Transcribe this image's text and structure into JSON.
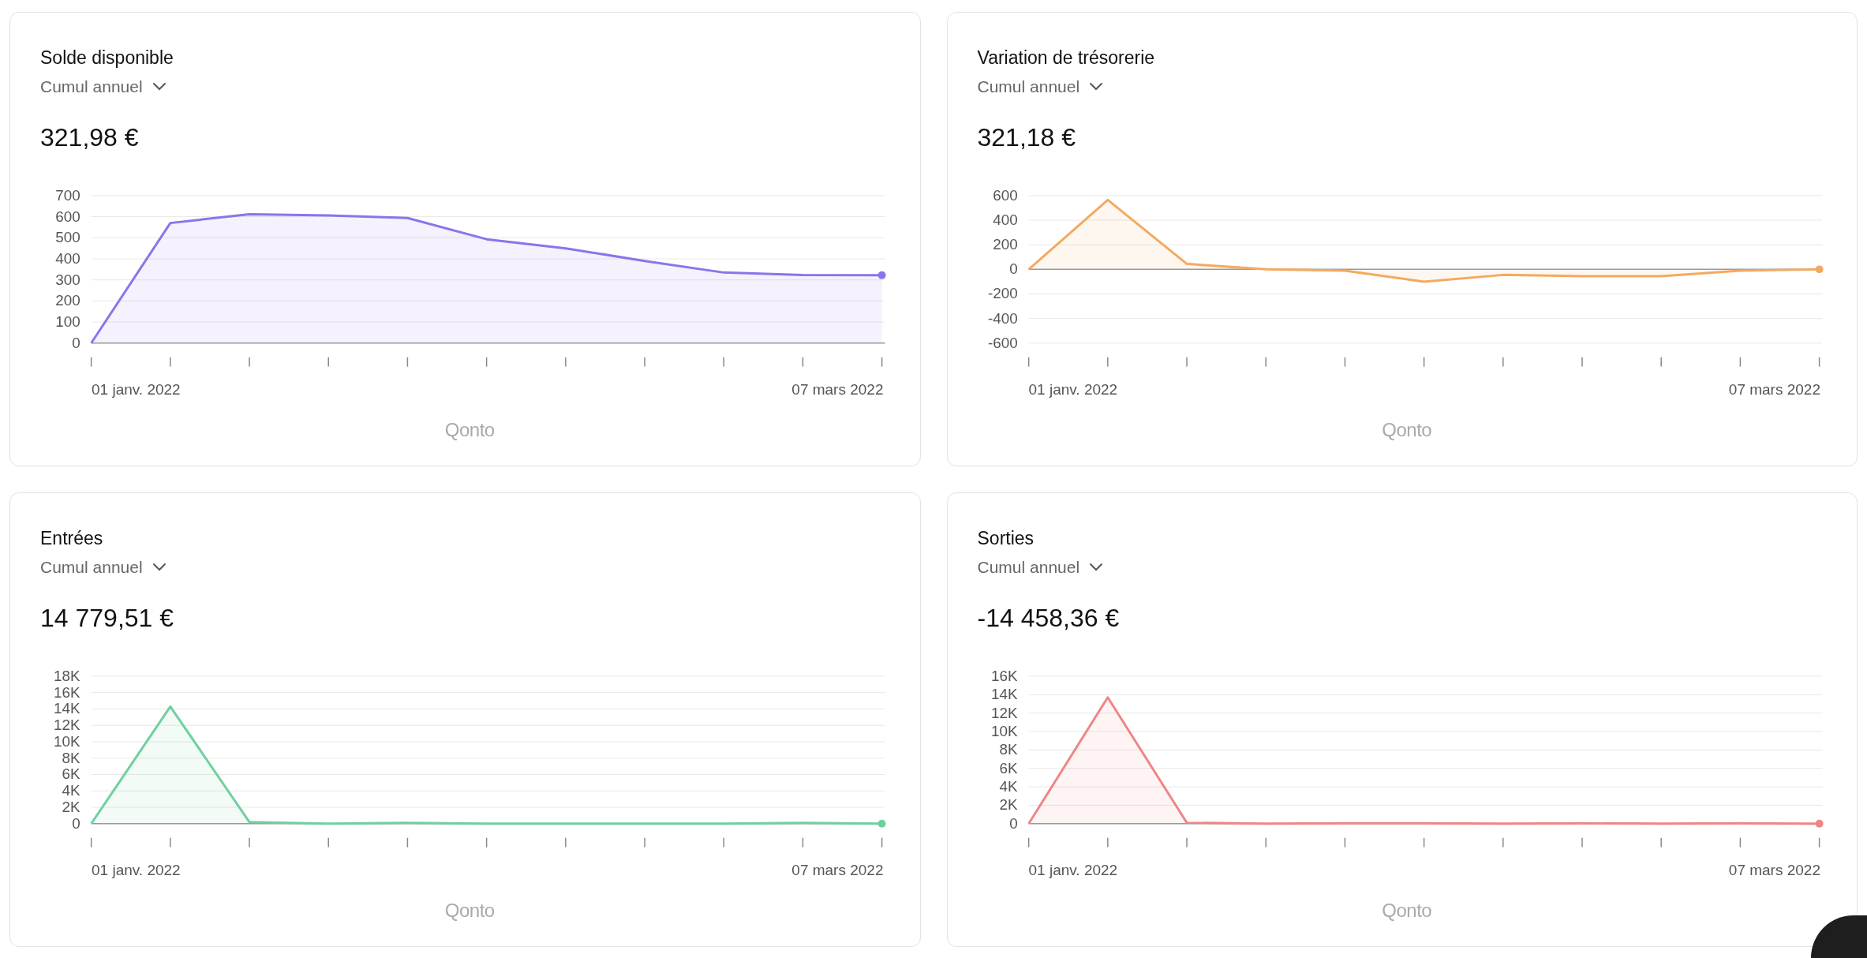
{
  "cards": [
    {
      "title": "Solde disponible",
      "period": "Cumul annuel",
      "amount": "321,98 €",
      "chart_data": {
        "type": "area",
        "grid": true,
        "categories": [
          null,
          null,
          null,
          null,
          null,
          null,
          null,
          null,
          null,
          null,
          null
        ],
        "ylim": [
          0,
          700
        ],
        "yticks": [
          0,
          100,
          200,
          300,
          400,
          500,
          600,
          700
        ],
        "series": [
          {
            "color": "#8b74ea",
            "values": [
              0,
              570,
              612,
              606,
              594,
              493,
              450,
              390,
              335,
              323,
              322
            ]
          }
        ]
      },
      "date_start": "01 janv. 2022",
      "date_end": "07 mars 2022",
      "logo": "Qonto"
    },
    {
      "title": "Variation de trésorerie",
      "period": "Cumul annuel",
      "amount": "321,18 €",
      "chart_data": {
        "type": "area",
        "grid": true,
        "categories": [
          null,
          null,
          null,
          null,
          null,
          null,
          null,
          null,
          null,
          null,
          null
        ],
        "ylim": [
          -600,
          600
        ],
        "yticks": [
          -600,
          -400,
          -200,
          0,
          200,
          400,
          600
        ],
        "series": [
          {
            "color": "#f4a95e",
            "values": [
              0,
              565,
              45,
              0,
              -10,
              -100,
              -45,
              -55,
              -55,
              -10,
              0
            ]
          }
        ]
      },
      "date_start": "01 janv. 2022",
      "date_end": "07 mars 2022",
      "logo": "Qonto"
    },
    {
      "title": "Entrées",
      "period": "Cumul annuel",
      "amount": "14 779,51 €",
      "chart_data": {
        "type": "area",
        "grid": true,
        "categories": [
          null,
          null,
          null,
          null,
          null,
          null,
          null,
          null,
          null,
          null,
          null
        ],
        "ylim": [
          0,
          18000
        ],
        "yticks": [
          0,
          {
            "value": 2000,
            "label": "2K"
          },
          {
            "value": 4000,
            "label": "4K"
          },
          {
            "value": 6000,
            "label": "6K"
          },
          {
            "value": 8000,
            "label": "8K"
          },
          {
            "value": 10000,
            "label": "10K"
          },
          {
            "value": 12000,
            "label": "12K"
          },
          {
            "value": 14000,
            "label": "14K"
          },
          {
            "value": 16000,
            "label": "16K"
          },
          {
            "value": 18000,
            "label": "18K"
          }
        ],
        "series": [
          {
            "color": "#6fd09e",
            "values": [
              0,
              14300,
              200,
              0,
              100,
              0,
              0,
              0,
              0,
              100,
              0
            ]
          }
        ]
      },
      "date_start": "01 janv. 2022",
      "date_end": "07 mars 2022",
      "logo": "Qonto"
    },
    {
      "title": "Sorties",
      "period": "Cumul annuel",
      "amount": "-14 458,36 €",
      "chart_data": {
        "type": "area",
        "grid": true,
        "categories": [
          null,
          null,
          null,
          null,
          null,
          null,
          null,
          null,
          null,
          null,
          null
        ],
        "ylim": [
          0,
          16000
        ],
        "yticks": [
          0,
          {
            "value": 2000,
            "label": "2K"
          },
          {
            "value": 4000,
            "label": "4K"
          },
          {
            "value": 6000,
            "label": "6K"
          },
          {
            "value": 8000,
            "label": "8K"
          },
          {
            "value": 10000,
            "label": "10K"
          },
          {
            "value": 12000,
            "label": "12K"
          },
          {
            "value": 14000,
            "label": "14K"
          },
          {
            "value": 16000,
            "label": "16K"
          }
        ],
        "series": [
          {
            "color": "#ef8585",
            "values": [
              0,
              13700,
              100,
              0,
              50,
              50,
              0,
              50,
              0,
              50,
              0
            ]
          }
        ]
      },
      "date_start": "01 janv. 2022",
      "date_end": "07 mars 2022",
      "logo": "Qonto"
    }
  ]
}
